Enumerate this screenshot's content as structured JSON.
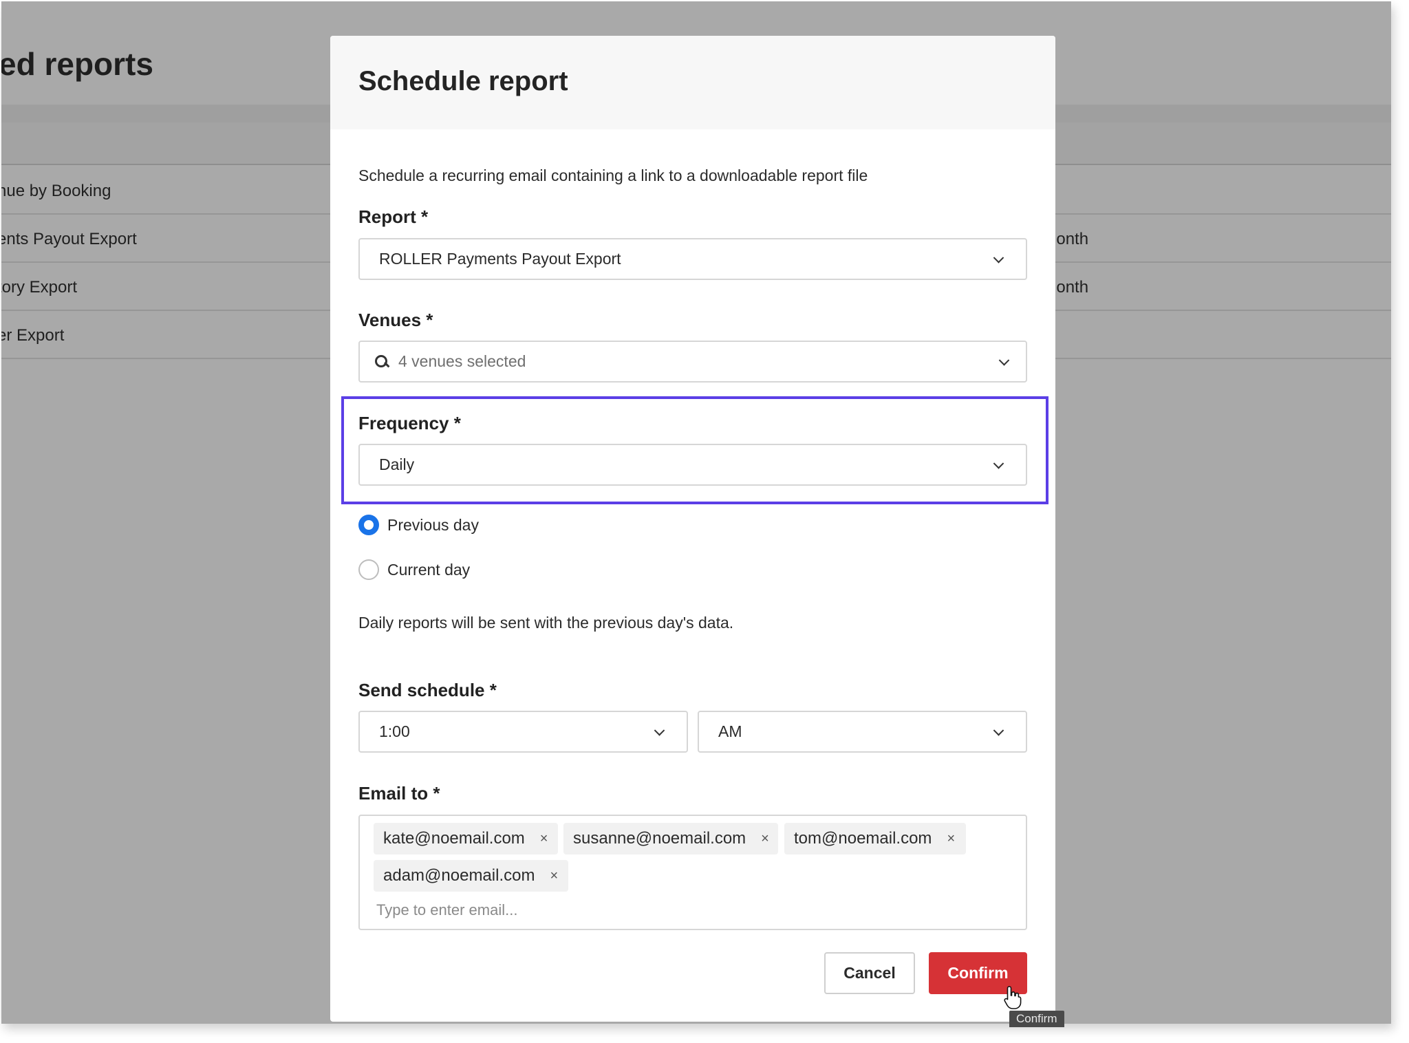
{
  "background": {
    "page_title": "ed reports",
    "rows": [
      {
        "left": "nue by Booking",
        "right": ""
      },
      {
        "left": "ents Payout Export",
        "right": "nonth"
      },
      {
        "left": "tory Export",
        "right": "nonth"
      },
      {
        "left": "er Export",
        "right": ""
      }
    ]
  },
  "modal": {
    "title": "Schedule report",
    "description": "Schedule a recurring email containing a link to a downloadable report file",
    "report": {
      "label": "Report *",
      "value": "ROLLER Payments Payout Export"
    },
    "venues": {
      "label": "Venues *",
      "value": "4 venues selected",
      "highlight_color": "#5b3fe6"
    },
    "frequency": {
      "label": "Frequency *",
      "value": "Daily",
      "options": [
        {
          "label": "Previous day",
          "checked": true
        },
        {
          "label": "Current day",
          "checked": false
        }
      ],
      "helper": "Daily reports will be sent with the previous day's data."
    },
    "send_schedule": {
      "label": "Send schedule *",
      "time": "1:00",
      "period": "AM"
    },
    "email": {
      "label": "Email to *",
      "chips": [
        "kate@noemail.com",
        "susanne@noemail.com",
        "tom@noemail.com",
        "adam@noemail.com"
      ],
      "remove_glyph": "×",
      "placeholder": "Type to enter email..."
    },
    "buttons": {
      "cancel": "Cancel",
      "confirm": "Confirm",
      "confirm_color": "#d63236"
    },
    "tooltip": "Confirm"
  }
}
